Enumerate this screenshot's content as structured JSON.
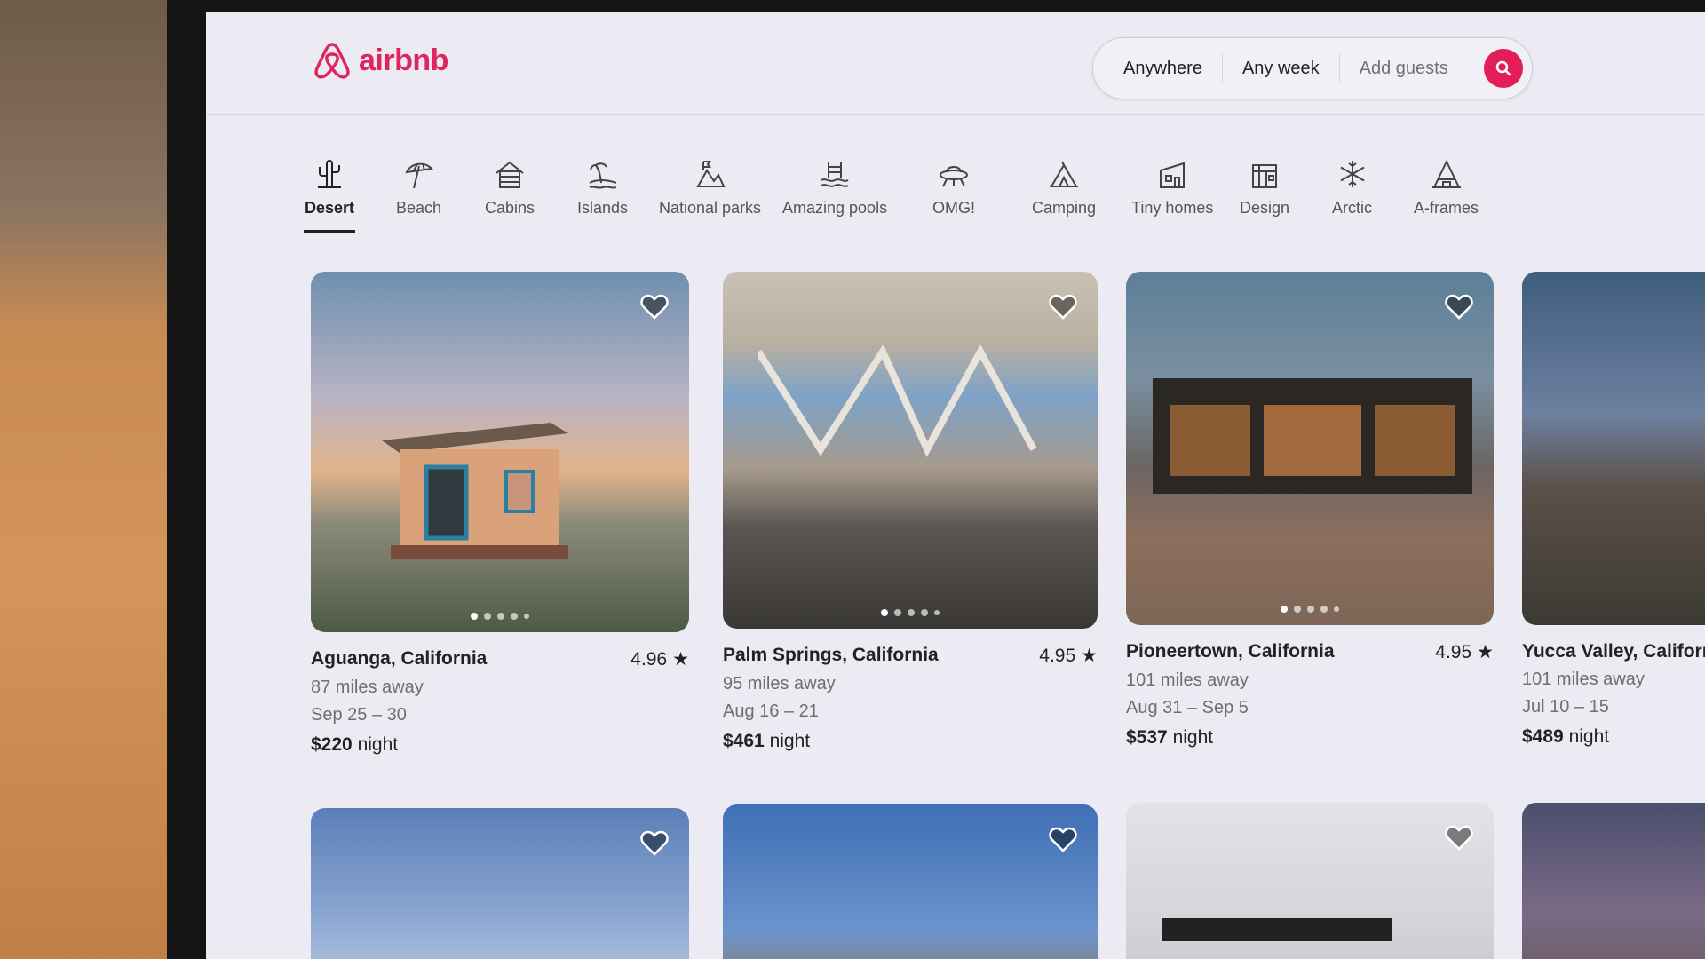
{
  "brand": {
    "name": "airbnb",
    "color": "#e0245e"
  },
  "search": {
    "location": "Anywhere",
    "dates": "Any week",
    "guests": "Add guests",
    "button_icon": "search-icon",
    "button_color": "#e21d58"
  },
  "categories": [
    {
      "label": "Desert",
      "icon": "cactus-icon",
      "active": true
    },
    {
      "label": "Beach",
      "icon": "umbrella-icon"
    },
    {
      "label": "Cabins",
      "icon": "cabin-icon"
    },
    {
      "label": "Islands",
      "icon": "island-icon"
    },
    {
      "label": "National parks",
      "icon": "mountain-flag-icon"
    },
    {
      "label": "Amazing pools",
      "icon": "pool-icon"
    },
    {
      "label": "OMG!",
      "icon": "ufo-icon"
    },
    {
      "label": "Camping",
      "icon": "tent-icon"
    },
    {
      "label": "Tiny homes",
      "icon": "tiny-home-icon"
    },
    {
      "label": "Design",
      "icon": "building-icon"
    },
    {
      "label": "Arctic",
      "icon": "snowflake-icon"
    },
    {
      "label": "A-frames",
      "icon": "a-frame-icon"
    }
  ],
  "listings": [
    {
      "title": "Aguanga, California",
      "rating": "4.96",
      "distance": "87 miles away",
      "dates": "Sep 25 – 30",
      "price": "$220",
      "price_unit": "night"
    },
    {
      "title": "Palm Springs, California",
      "rating": "4.95",
      "distance": "95 miles away",
      "dates": "Aug 16 – 21",
      "price": "$461",
      "price_unit": "night"
    },
    {
      "title": "Pioneertown, California",
      "rating": "4.95",
      "distance": "101 miles away",
      "dates": "Aug 31 – Sep 5",
      "price": "$537",
      "price_unit": "night"
    },
    {
      "title": "Yucca Valley, Califorr",
      "rating": "",
      "distance": "101 miles away",
      "dates": "Jul 10 – 15",
      "price": "$489",
      "price_unit": "night"
    }
  ]
}
